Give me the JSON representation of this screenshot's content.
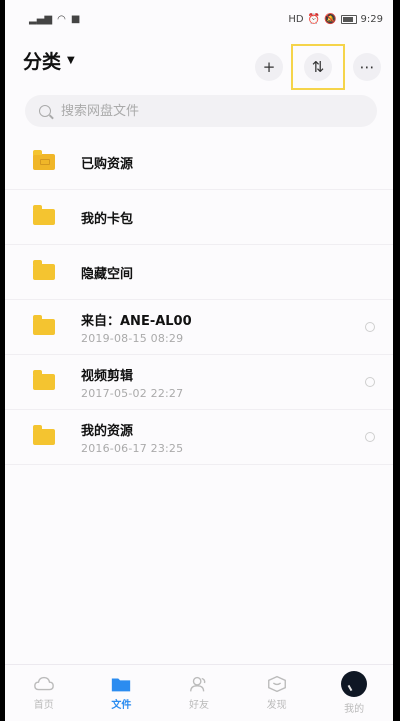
{
  "status": {
    "left_icons": [
      "signal-icon",
      "wifi-icon",
      "app-icon"
    ],
    "right_icons": [
      "hd-icon",
      "alarm-icon",
      "mute-icon",
      "battery-icon"
    ],
    "time": "9:29"
  },
  "header": {
    "title": "分类",
    "add_label": "+",
    "sort_label": "⇅",
    "more_label": "⋯"
  },
  "search": {
    "placeholder": "搜索网盘文件"
  },
  "items": [
    {
      "name": "已购资源",
      "type": "purchased"
    },
    {
      "name": "我的卡包",
      "type": "folder"
    },
    {
      "name": "隐藏空间",
      "type": "folder"
    },
    {
      "name": "来自：ANE-AL00",
      "date": "2019-08-15  08:29",
      "type": "folder"
    },
    {
      "name": "视频剪辑",
      "date": "2017-05-02  22:27",
      "type": "folder"
    },
    {
      "name": "我的资源",
      "date": "2016-06-17  23:25",
      "type": "folder"
    }
  ],
  "nav": [
    {
      "label": "首页",
      "icon": "cloud-icon"
    },
    {
      "label": "文件",
      "icon": "folder-icon",
      "active": true
    },
    {
      "label": "好友",
      "icon": "friends-icon"
    },
    {
      "label": "发现",
      "icon": "discover-icon"
    },
    {
      "label": "我的",
      "icon": "avatar"
    }
  ],
  "colors": {
    "accent": "#2b8cf0",
    "folder": "#f4c430",
    "highlight": "#f5d44a"
  }
}
